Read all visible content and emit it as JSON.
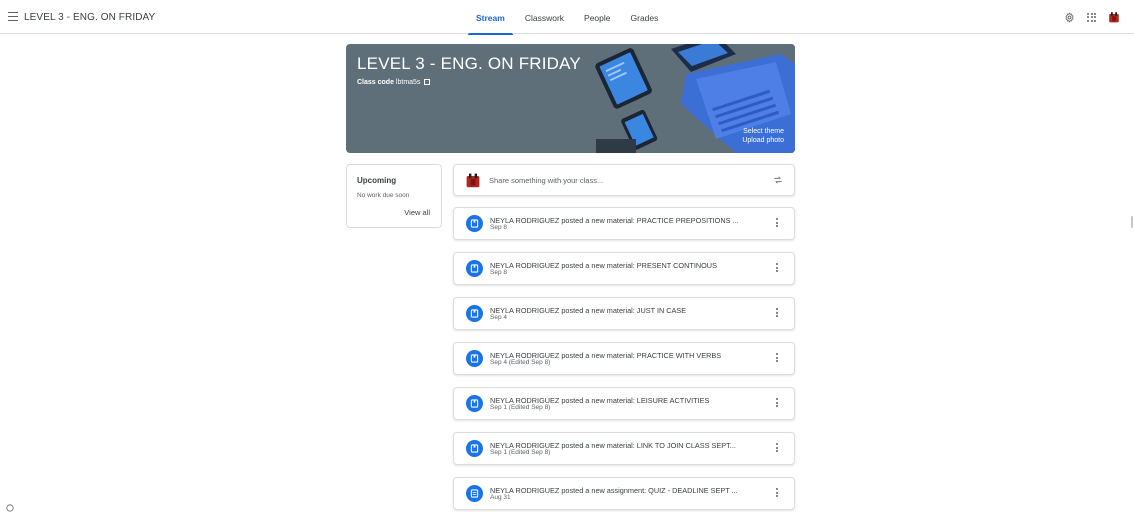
{
  "header": {
    "class_title": "LEVEL 3 - ENG. ON FRIDAY",
    "tabs": [
      {
        "label": "Stream",
        "active": true
      },
      {
        "label": "Classwork",
        "active": false
      },
      {
        "label": "People",
        "active": false
      },
      {
        "label": "Grades",
        "active": false
      }
    ],
    "icons": [
      "menu-icon",
      "gear-icon",
      "apps-icon",
      "avatar"
    ]
  },
  "banner": {
    "title": "LEVEL 3 - ENG. ON FRIDAY",
    "class_code_label": "Class code",
    "class_code_value": "lbtma5s",
    "select_theme": "Select theme",
    "upload_photo": "Upload photo",
    "background_color": "#5f6f7a"
  },
  "upcoming": {
    "title": "Upcoming",
    "status": "No work due soon",
    "view_all": "View all"
  },
  "share": {
    "placeholder": "Share something with your class..."
  },
  "posts": [
    {
      "title": "NEYLA RODRIGUEZ posted a new material: PRACTICE PREPOSITIONS ...",
      "date": "Sep 8",
      "icon": "material-icon"
    },
    {
      "title": "NEYLA RODRIGUEZ posted a new material: PRESENT CONTINOUS",
      "date": "Sep 8",
      "icon": "material-icon"
    },
    {
      "title": "NEYLA RODRIGUEZ posted a new material: JUST IN CASE",
      "date": "Sep 4",
      "icon": "material-icon"
    },
    {
      "title": "NEYLA RODRIGUEZ posted a new material: PRACTICE WITH VERBS",
      "date": "Sep 4 (Edited Sep 8)",
      "icon": "material-icon"
    },
    {
      "title": "NEYLA RODRIGUEZ posted a new material: LEISURE ACTIVITIES",
      "date": "Sep 1 (Edited Sep 8)",
      "icon": "material-icon"
    },
    {
      "title": "NEYLA RODRIGUEZ posted a new material: LINK TO JOIN CLASS SEPT...",
      "date": "Sep 1 (Edited Sep 8)",
      "icon": "material-icon"
    },
    {
      "title": "NEYLA RODRIGUEZ posted a new assignment: QUIZ - DEADLINE SEPT ...",
      "date": "Aug 31",
      "icon": "assignment-icon"
    }
  ],
  "colors": {
    "accent": "#1967d2",
    "post_icon": "#1a73e8",
    "border": "#dadce0"
  }
}
